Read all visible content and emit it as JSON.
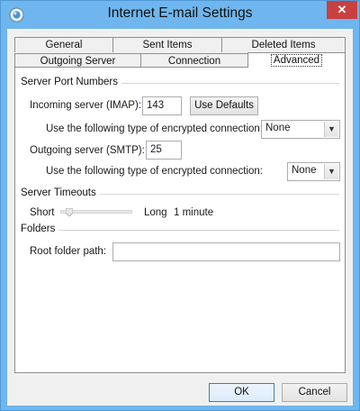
{
  "window": {
    "title": "Internet E-mail Settings",
    "close_glyph": "✕",
    "icon": "outlook-app-icon"
  },
  "tabs": {
    "row1": [
      "General",
      "Sent Items",
      "Deleted Items"
    ],
    "row2": [
      "Outgoing Server",
      "Connection",
      "Advanced"
    ],
    "active": "Advanced"
  },
  "server_ports": {
    "heading": "Server Port Numbers",
    "incoming_label": "Incoming server (IMAP):",
    "incoming_value": "143",
    "use_defaults_label": "Use Defaults",
    "incoming_encryption_label": "Use the following type of encrypted connection:",
    "incoming_encryption_value": "None",
    "outgoing_label": "Outgoing server (SMTP):",
    "outgoing_value": "25",
    "outgoing_encryption_label": "Use the following type of encrypted connection:",
    "outgoing_encryption_value": "None"
  },
  "server_timeouts": {
    "heading": "Server Timeouts",
    "short_label": "Short",
    "long_label": "Long",
    "value_text": "1 minute",
    "slider_level": 0
  },
  "folders": {
    "heading": "Folders",
    "root_folder_label": "Root folder path:",
    "root_folder_value": ""
  },
  "footer": {
    "ok_label": "OK",
    "cancel_label": "Cancel"
  }
}
